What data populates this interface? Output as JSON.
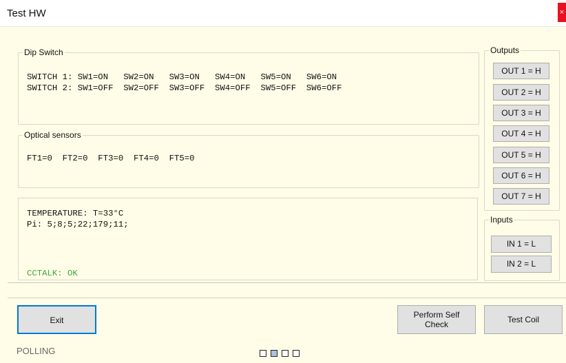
{
  "window": {
    "title": "Test HW",
    "close_glyph": "×"
  },
  "dip_switch": {
    "legend": "Dip Switch",
    "line1": "SWITCH 1: SW1=ON   SW2=ON   SW3=ON   SW4=ON   SW5=ON   SW6=ON",
    "line2": "SWITCH 2: SW1=OFF  SW2=OFF  SW3=OFF  SW4=OFF  SW5=OFF  SW6=OFF"
  },
  "optical": {
    "legend": "Optical sensors",
    "line1": "FT1=0  FT2=0  FT3=0  FT4=0  FT5=0"
  },
  "info": {
    "temperature": "TEMPERATURE: T=33°C",
    "pi": "Pi: 5;8;5;22;179;11;",
    "cctalk": "CCTALK: OK",
    "cctalk_color": "#3fa63f"
  },
  "outputs": {
    "legend": "Outputs",
    "buttons": [
      "OUT 1 = H",
      "OUT 2 = H",
      "OUT 3 = H",
      "OUT 4 = H",
      "OUT 5 = H",
      "OUT 6 = H",
      "OUT 7 = H"
    ]
  },
  "inputs": {
    "legend": "Inputs",
    "buttons": [
      "IN 1 = L",
      "IN 2 = L"
    ]
  },
  "actions": {
    "exit_label": "Exit",
    "self_check_label_1": "Perform Self",
    "self_check_label_2": "Check",
    "test_coil_label": "Test Coil"
  },
  "status": {
    "text": "POLLING",
    "indicator_count": 4,
    "active_indicator": 2,
    "active_color": "#a9c4dc"
  }
}
